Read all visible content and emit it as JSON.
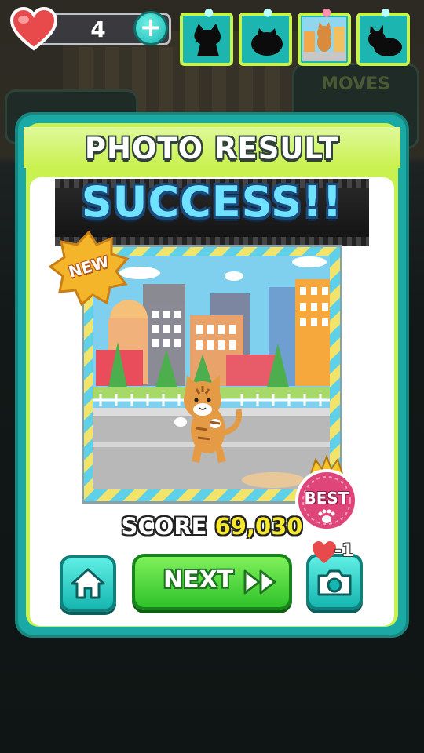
{
  "hud": {
    "lives": "4",
    "plus_symbol": "+",
    "heart_icon": "heart-icon",
    "plus_icon": "plus-icon",
    "cat_slots": [
      {
        "state": "silhouette",
        "icon": "cat-silhouette-icon"
      },
      {
        "state": "silhouette",
        "icon": "cat-curled-silhouette-icon"
      },
      {
        "state": "photographed",
        "icon": "cat-photo-thumbnail"
      },
      {
        "state": "silhouette",
        "icon": "cat-lying-silhouette-icon"
      }
    ]
  },
  "background": {
    "moves_label": "MOVES"
  },
  "dialog": {
    "title": "PHOTO RESULT",
    "banner": "SUCCESS!!",
    "new_badge": "NEW",
    "best_badge": "BEST",
    "score_label": "SCORE",
    "score_value": "69,030",
    "next_label": "NEXT",
    "next_icon": "fast-forward-icon",
    "home_icon": "home-icon",
    "camera_icon": "camera-icon",
    "retake_cost": "-1"
  },
  "colors": {
    "dialog_teal": "#1ba9a6",
    "dialog_lime": "#c9f14f",
    "success_text": "#6fe2ff",
    "score_yellow": "#f6e82c",
    "next_green": "#2fc22a",
    "best_pink": "#e0457a",
    "new_gold": "#f5b52a"
  }
}
